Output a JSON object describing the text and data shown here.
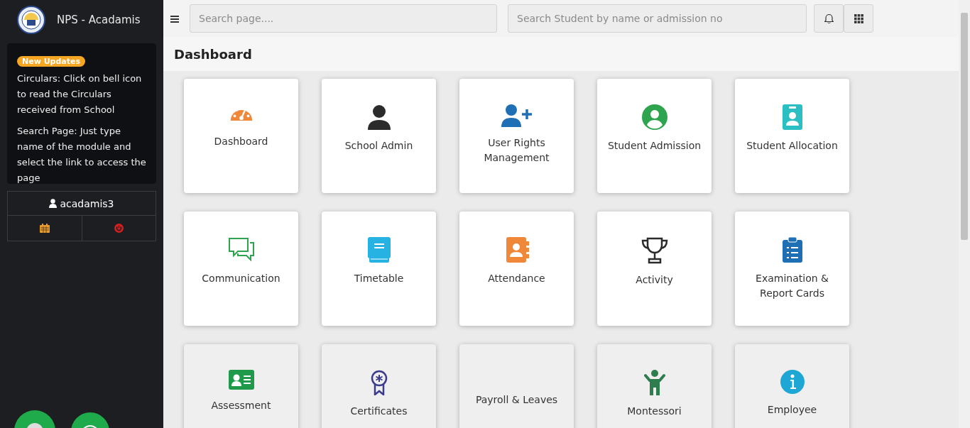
{
  "brand": {
    "title": "NPS - Acadamis"
  },
  "updates": {
    "badge": "New Updates",
    "notes": [
      "Circulars: Click on bell icon to read the Circulars received from School",
      "Search Page: Just type name of the module and select the link to access the page"
    ]
  },
  "user": {
    "name": "acadamis3"
  },
  "topbar": {
    "page_search": {
      "placeholder": "Search page...."
    },
    "student_search": {
      "placeholder": "Search Student by name or admission no"
    }
  },
  "page_title": "Dashboard",
  "tiles": [
    {
      "label": "Dashboard"
    },
    {
      "label": "School Admin"
    },
    {
      "label": "User Rights Management"
    },
    {
      "label": "Student Admission"
    },
    {
      "label": "Student Allocation"
    },
    {
      "label": "Communication"
    },
    {
      "label": "Timetable"
    },
    {
      "label": "Attendance"
    },
    {
      "label": "Activity"
    },
    {
      "label": "Examination & Report Cards"
    },
    {
      "label": "Assessment"
    },
    {
      "label": "Certificates"
    },
    {
      "label": "Payroll & Leaves"
    },
    {
      "label": "Montessori"
    },
    {
      "label": "Employee"
    }
  ]
}
